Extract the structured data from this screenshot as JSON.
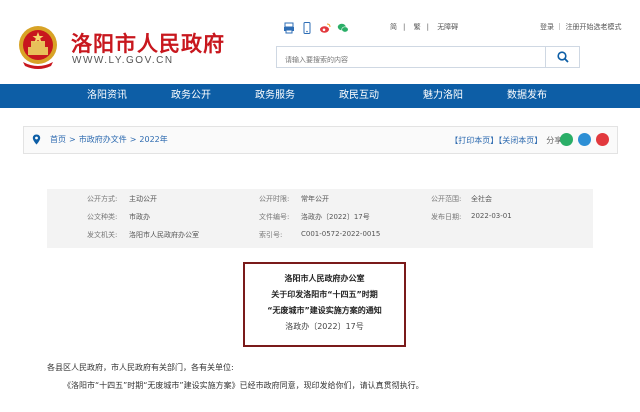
{
  "header": {
    "title": "洛阳市人民政府",
    "url": "WWW.LY.GOV.CN",
    "icons": [
      "print-icon",
      "mobile-icon",
      "weibo-icon",
      "wechat-icon"
    ],
    "langs": [
      "简",
      "繁",
      "无障碍"
    ],
    "user_links": "登录 ｜ 注册开始选老模式"
  },
  "search": {
    "placeholder": "请输入要搜索的内容"
  },
  "nav": [
    "洛阳资讯",
    "政务公开",
    "政务服务",
    "政民互动",
    "魅力洛阳",
    "数据发布"
  ],
  "breadcrumb": {
    "home": "首页",
    "level1": "市政府办文件",
    "level2": "2022年",
    "sep": ">"
  },
  "tools": {
    "print": "【打印本页】",
    "close": "【关闭本页】",
    "share": "分享:"
  },
  "meta": {
    "row1": [
      [
        "公开方式:",
        "主动公开"
      ],
      [
        "公开时限:",
        "常年公开"
      ],
      [
        "公开范围:",
        "全社会"
      ]
    ],
    "row2": [
      [
        "公文种类:",
        "市政办"
      ],
      [
        "文件编号:",
        "洛政办〔2022〕17号"
      ],
      [
        "发布日期:",
        "2022-03-01"
      ]
    ],
    "row3": [
      [
        "发文机关:",
        "洛阳市人民政府办公室"
      ],
      [
        "索引号:",
        "C001-0572-2022-0015"
      ]
    ]
  },
  "doc": {
    "issuer": "洛阳市人民政府办公室",
    "title_line1": "关于印发洛阳市“十四五”时期",
    "title_line2": "“无废城市”建设实施方案的通知",
    "number": "洛政办〔2022〕17号"
  },
  "body": {
    "greeting": "各县区人民政府，市人民政府有关部门，各有关单位:",
    "para1": "《洛阳市“十四五”时期“无废城市”建设实施方案》已经市政府同意，现印发给你们，请认真贯彻执行。"
  },
  "colors": {
    "brand_red": "#c8171e",
    "nav_blue": "#0d5ea6",
    "box_border": "#7a1a1a"
  }
}
